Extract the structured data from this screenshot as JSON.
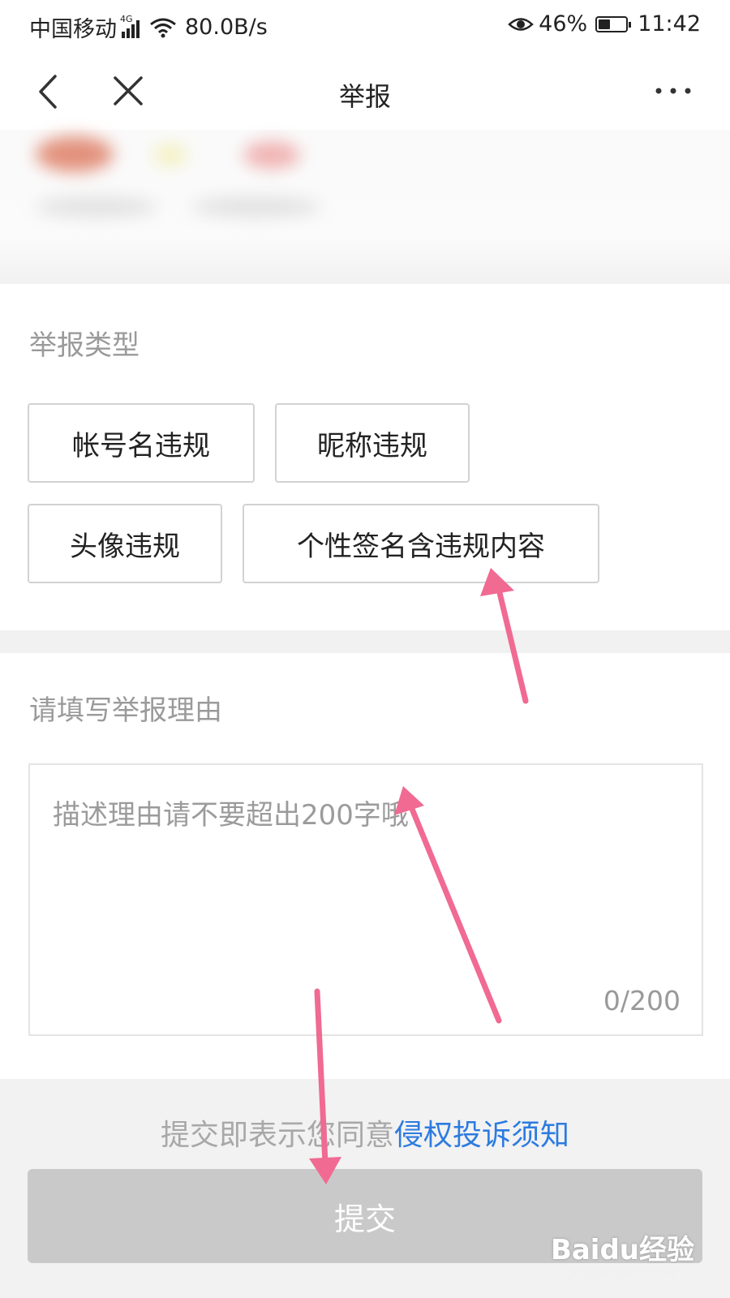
{
  "status_bar": {
    "carrier": "中国移动",
    "network": "4G",
    "speed": "80.0B/s",
    "battery": "46%",
    "time": "11:42"
  },
  "nav": {
    "title": "举报"
  },
  "report_type": {
    "title": "举报类型",
    "options": [
      "帐号名违规",
      "昵称违规",
      "头像违规",
      "个性签名含违规内容"
    ]
  },
  "reason": {
    "title": "请填写举报理由",
    "placeholder": "描述理由请不要超出200字哦",
    "value": "",
    "counter": "0/200"
  },
  "footer": {
    "agreement_prefix": "提交即表示您同意",
    "agreement_link": "侵权投诉须知",
    "submit_label": "提交"
  },
  "watermark": {
    "main": "Baidu经验",
    "sub": "jingyan.baidu.com"
  },
  "colors": {
    "link": "#2d7be0",
    "submit_disabled": "#c9c9c9",
    "arrow": "#f06a92"
  }
}
